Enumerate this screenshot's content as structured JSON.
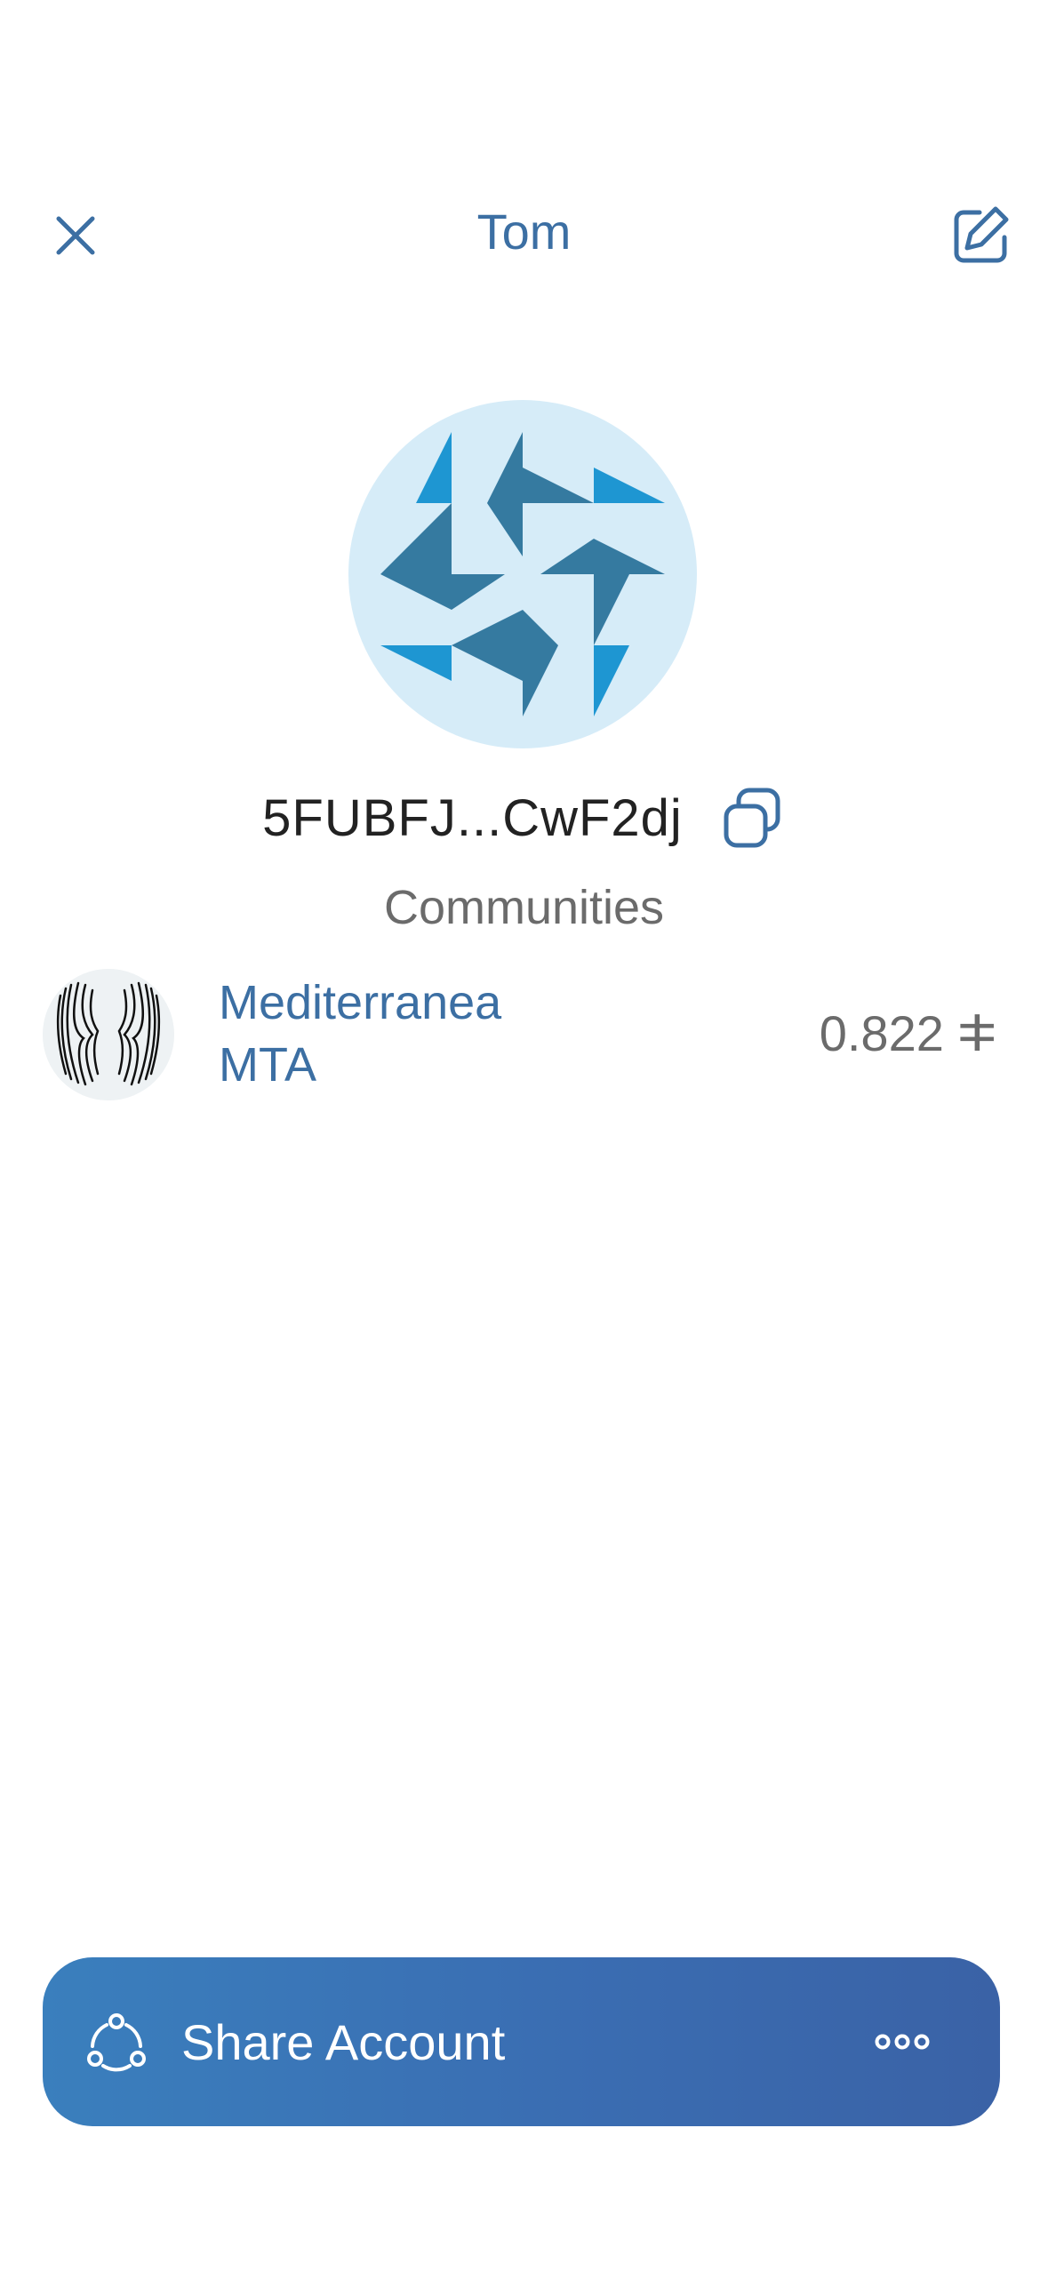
{
  "header": {
    "title": "Tom",
    "close_icon": "close-icon",
    "edit_icon": "edit-icon"
  },
  "account": {
    "identicon": "account-identicon",
    "address": "5FUBFJ...CwF2dj",
    "copy_icon": "copy-icon"
  },
  "communities": {
    "title": "Communities",
    "items": [
      {
        "name": "Mediterranea",
        "symbol": "MTA",
        "balance": "0.822 ⵐ",
        "avatar": "mediterranea-logo"
      }
    ]
  },
  "share": {
    "label": "Share Account",
    "share_icon": "share-icon",
    "more_icon": "more-icon"
  },
  "colors": {
    "accent": "#3c6fa3",
    "identicon_bg": "#d6ecf8",
    "identicon_dark": "#357aa0",
    "identicon_light": "#1e96d2",
    "button_gradient_start": "#3a7fbd",
    "button_gradient_end": "#3a62a6"
  }
}
